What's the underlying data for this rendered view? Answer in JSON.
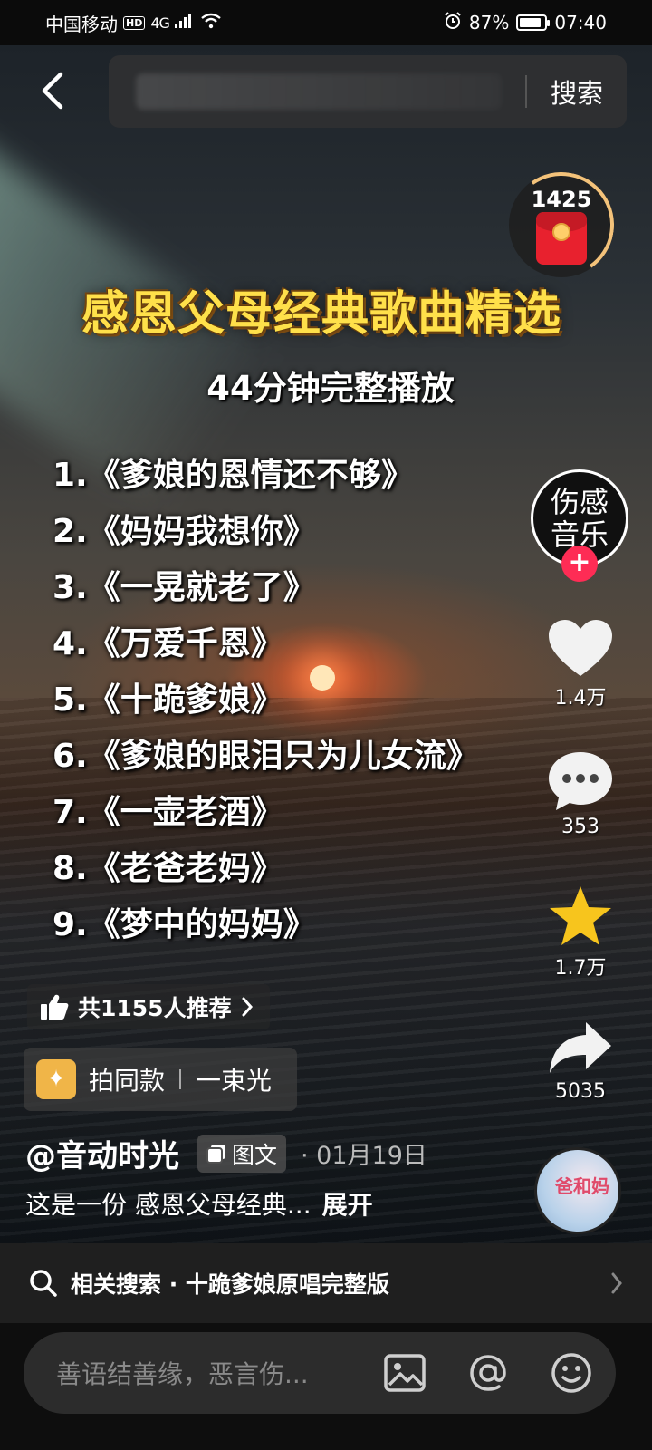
{
  "status_bar": {
    "carrier": "中国移动",
    "hd": "HD",
    "network": "4G",
    "battery_percent": "87%",
    "battery_level": 0.87,
    "time": "07:40"
  },
  "search": {
    "button_label": "搜索"
  },
  "red_packet": {
    "count": "1425"
  },
  "post": {
    "title": "感恩父母经典歌曲精选",
    "subtitle": "44分钟完整播放",
    "songs": [
      "1.《爹娘的恩情还不够》",
      "2.《妈妈我想你》",
      "3.《一晃就老了》",
      "4.《万爱千恩》",
      "5.《十跪爹娘》",
      "6.《爹娘的眼泪只为儿女流》",
      "7.《一壶老酒》",
      "8.《老爸老妈》",
      "9.《梦中的妈妈》"
    ]
  },
  "creator_avatar": {
    "text": "伤感音乐",
    "follow": "+"
  },
  "actions": {
    "likes": "1.4万",
    "comments": "353",
    "favorites": "1.7万",
    "shares": "5035"
  },
  "music_disc": {
    "text": "爸和妈"
  },
  "recommend": {
    "text": "共1155人推荐"
  },
  "template": {
    "label": "拍同款",
    "song": "一束光"
  },
  "author": {
    "name": "@音动时光",
    "tag": "图文",
    "date": "· 01月19日"
  },
  "caption": {
    "text": "这是一份 感恩父母经典...",
    "expand": "展开"
  },
  "related_search": {
    "text": "相关搜索 · 十跪爹娘原唱完整版"
  },
  "comment_bar": {
    "placeholder": "善语结善缘，恶言伤..."
  },
  "colors": {
    "accent_red": "#fe2c55",
    "title_yellow": "#ffe04a",
    "star_yellow": "#f7c51d"
  }
}
